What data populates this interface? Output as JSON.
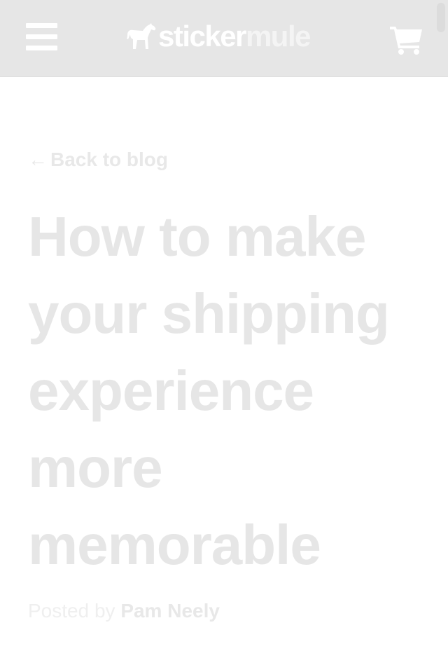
{
  "header": {
    "logo_part1": "sticker",
    "logo_part2": "mule",
    "menu_icon": "hamburger-menu-icon",
    "cart_icon": "shopping-cart-icon",
    "background": "#e6e6e6"
  },
  "article": {
    "back_arrow": "←",
    "back_label": "Back to blog",
    "title": "How to make your shipping experience more memorable",
    "posted_by": "Posted by",
    "author": "Pam Neely"
  },
  "colors": {
    "header_bg": "#e6e6e6",
    "logo_white": "#ffffff",
    "text_faded": "#e6e6e6"
  }
}
